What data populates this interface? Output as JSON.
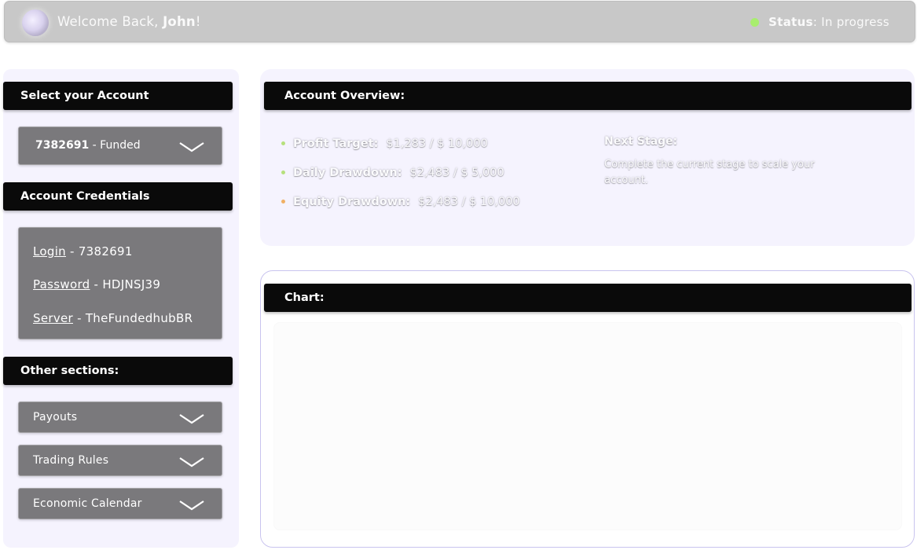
{
  "header": {
    "welcome_prefix": "Welcome Back, ",
    "user_name": "John",
    "welcome_suffix": "!",
    "status_label": "Status",
    "status_value": ": In progress",
    "status_color": "#a8ee6e",
    "logo_icon": "orb-logo-icon"
  },
  "sidebar": {
    "select_account_title": "Select your Account",
    "account_number": "7382691",
    "account_type": " - Funded",
    "credentials_title": "Account Credentials",
    "credentials": [
      {
        "key": "Login",
        "value": " - 7382691"
      },
      {
        "key": "Password",
        "value": " - HDJNSJ39"
      },
      {
        "key": "Server",
        "value": " - TheFundedhubBR"
      }
    ],
    "other_sections_title": "Other sections:",
    "sections": [
      {
        "label": "Payouts"
      },
      {
        "label": "Trading Rules"
      },
      {
        "label": "Economic Calendar"
      }
    ],
    "dropdown_icon": "chevron-down-icon"
  },
  "overview": {
    "title": "Account Overview:",
    "items": [
      {
        "label": "Profit Target:",
        "value": "$1,283 /  $ 10,000",
        "dot_color": "#b6e07c"
      },
      {
        "label": "Daily Drawdown:",
        "value": "$2,483 / $ 5,000",
        "dot_color": "#b6e07c"
      },
      {
        "label": "Equity Drawdown:",
        "value": "$2,483 /  $ 10,000",
        "dot_color": "#f0b064"
      }
    ],
    "next_stage_title": "Next Stage:",
    "next_stage_desc": "Complete the current stage to scale your account."
  },
  "chart": {
    "title": "Chart:"
  }
}
